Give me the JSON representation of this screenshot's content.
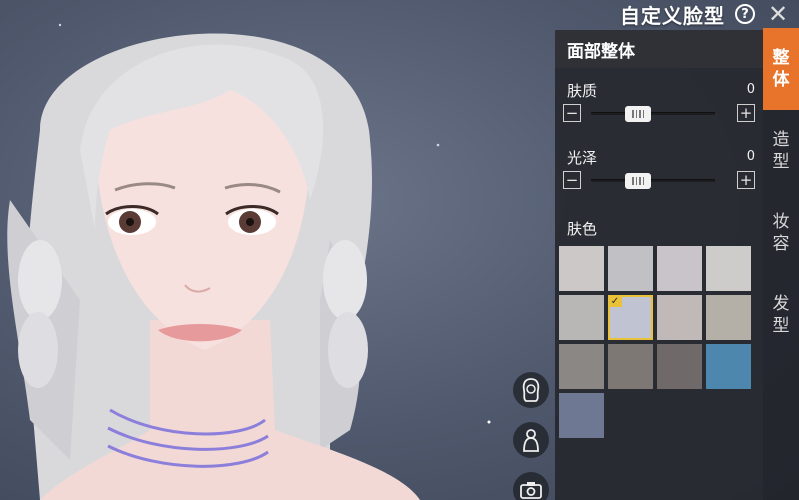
{
  "header": {
    "title": "自定义脸型",
    "help_icon": "help-icon",
    "close_icon": "close-icon",
    "close_label": "✕"
  },
  "tabs": [
    {
      "label_top": "整",
      "label_bottom": "体",
      "active": true
    },
    {
      "label_top": "造",
      "label_bottom": "型",
      "active": false
    },
    {
      "label_top": "妆",
      "label_bottom": "容",
      "active": false
    },
    {
      "label_top": "发",
      "label_bottom": "型",
      "active": false
    }
  ],
  "panel": {
    "title": "面部整体",
    "sliders": [
      {
        "label": "肤质",
        "value": "0",
        "level": 0.35
      },
      {
        "label": "光泽",
        "value": "0",
        "level": 0.35
      }
    ],
    "minus_label": "−",
    "plus_label": "+",
    "skin_color_label": "肤色",
    "swatches": [
      "#ccc8c8",
      "#c1c0c4",
      "#c9c4c9",
      "#cecccb",
      "#b9b6b6",
      "#c0c3d2",
      "#c0b9b7",
      "#b4b0a8",
      "#8a8784",
      "#7e7875",
      "#6f6969",
      "#4d87ad",
      "#6f7893"
    ],
    "selected_swatch_index": 5,
    "check_mark": "✓"
  },
  "side_icons": [
    "hair-front-icon",
    "hair-back-icon",
    "camera-icon"
  ],
  "colors": {
    "accent": "#e8732a",
    "panel_bg": "#26282e",
    "check": "#e9c23a"
  }
}
